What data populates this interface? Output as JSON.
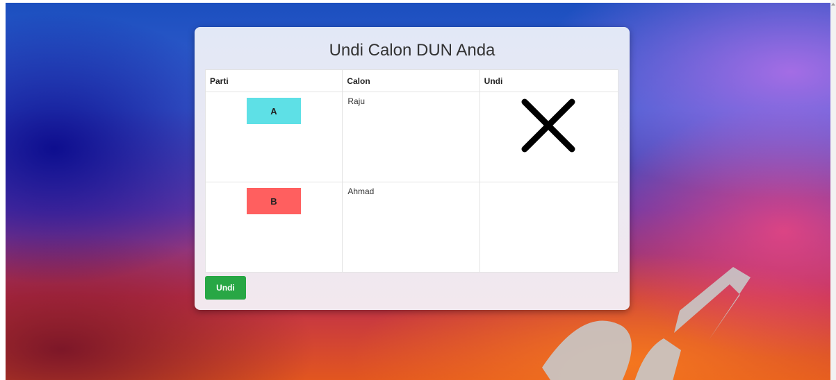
{
  "card": {
    "title": "Undi Calon DUN Anda"
  },
  "table": {
    "headers": [
      "Parti",
      "Calon",
      "Undi"
    ],
    "rows": [
      {
        "party": "A",
        "party_color": "#5ee0e6",
        "candidate": "Raju",
        "voted": true
      },
      {
        "party": "B",
        "party_color": "#ff5f5f",
        "candidate": "Ahmad",
        "voted": false
      }
    ]
  },
  "actions": {
    "submit_label": "Undi"
  },
  "icons": {
    "vote_mark": "x-mark-icon"
  },
  "colors": {
    "submit_button": "#28a745",
    "watermark": "#c8c8c8"
  }
}
